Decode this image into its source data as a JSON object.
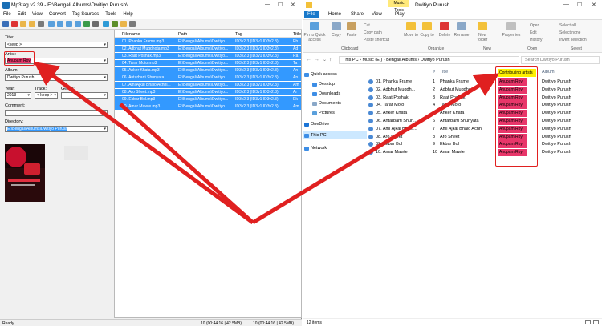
{
  "mp3tag": {
    "title": "Mp3tag v2.39  -  E:\\Bengali Albums\\Dwitiyo Purush\\",
    "menu": [
      "File",
      "Edit",
      "View",
      "Convert",
      "Tag Sources",
      "Tools",
      "Help"
    ],
    "fields": {
      "title_label": "Title:",
      "title_value": "<keep >",
      "artist_label": "Artist:",
      "artist_value": "Anupam Roy",
      "album_label": "Album:",
      "album_value": "Dwitiyo Purush",
      "year_label": "Year:",
      "year_value": "2013",
      "track_label": "Track:",
      "track_value": "< keep >",
      "genre_label": "Genre:",
      "comment_label": "Comment:",
      "directory_label": "Directory:",
      "directory_value": "E:\\Bengali Albums\\Dwitiyo Purush"
    },
    "columns": [
      "Filename",
      "Path",
      "Tag",
      "Title"
    ],
    "files": [
      {
        "filename": "01. Phanka Frame.mp3",
        "path": "E:\\Bengali Albums\\Dwitiyo...",
        "tag": "ID3v2.3 (ID3v1 ID3v2.3)",
        "title": "Ph"
      },
      {
        "filename": "02. Adbhut Mugdhota.mp3",
        "path": "E:\\Bengali Albums\\Dwitiyo...",
        "tag": "ID3v2.3 (ID3v1 ID3v2.3)",
        "title": "Ad"
      },
      {
        "filename": "03. Raat Poshak.mp3",
        "path": "E:\\Bengali Albums\\Dwitiyo...",
        "tag": "ID3v2.3 (ID3v1 ID3v2.3)",
        "title": "Ra"
      },
      {
        "filename": "04. Tarar Moto.mp3",
        "path": "E:\\Bengali Albums\\Dwitiyo...",
        "tag": "ID3v2.3 (ID3v1 ID3v2.3)",
        "title": "Ta"
      },
      {
        "filename": "05. Anker Khata.mp3",
        "path": "E:\\Bengali Albums\\Dwitiyo...",
        "tag": "ID3v2.3 (ID3v1 ID3v2.3)",
        "title": "An"
      },
      {
        "filename": "06. Antarbarti Shunyata...",
        "path": "E:\\Bengali Albums\\Dwitiyo...",
        "tag": "ID3v2.3 (ID3v1 ID3v2.3)",
        "title": "An"
      },
      {
        "filename": "07. Ami Ajkal Bhalo Achhi...",
        "path": "E:\\Bengali Albums\\Dwitiyo...",
        "tag": "ID3v2.3 (ID3v1 ID3v2.3)",
        "title": "Am"
      },
      {
        "filename": "08. Aro Sheet.mp3",
        "path": "E:\\Bengali Albums\\Dwitiyo...",
        "tag": "ID3v2.3 (ID3v1 ID3v2.3)",
        "title": "Ar"
      },
      {
        "filename": "09. Ekbar Bol.mp3",
        "path": "E:\\Bengali Albums\\Dwitiyo...",
        "tag": "ID3v2.3 (ID3v1 ID3v2.3)",
        "title": "Ek"
      },
      {
        "filename": "10. Amar Mawte.mp3",
        "path": "E:\\Bengali Albums\\Dwitiyo...",
        "tag": "ID3v2.3 (ID3v1 ID3v2.3)",
        "title": "Am"
      }
    ],
    "status": {
      "left": "Ready",
      "mid": "10 (00:44:16 | 42.5MB)",
      "right": "10 (00:44:16 | 42.5MB)"
    }
  },
  "explorer": {
    "title": "Dwitiyo Purush",
    "music_tools": "Music Tools",
    "tabs": [
      "File",
      "Home",
      "Share",
      "View",
      "Play"
    ],
    "ribbon": {
      "pin": "Pin to Quick access",
      "copy": "Copy",
      "paste": "Paste",
      "cut": "Cut",
      "copy_path": "Copy path",
      "paste_shortcut": "Paste shortcut",
      "move_to": "Move to",
      "copy_to": "Copy to",
      "delete": "Delete",
      "rename": "Rename",
      "new_folder": "New folder",
      "properties": "Properties",
      "open": "Open",
      "edit": "Edit",
      "history": "History",
      "select_all": "Select all",
      "select_none": "Select none",
      "invert": "Invert selection",
      "groups": [
        "Clipboard",
        "Organize",
        "New",
        "Open",
        "Select"
      ]
    },
    "address": "This PC  ›  Music (E:)  ›  Bengali Albums  ›  Dwitiyo Purush",
    "search_placeholder": "Search Dwitiyo Purush",
    "nav": [
      "Quick access",
      "Desktop",
      "Downloads",
      "Documents",
      "Pictures",
      "OneDrive",
      "This PC",
      "Network"
    ],
    "columns": {
      "num": "#",
      "title": "Title",
      "contrib": "Contributing artists",
      "album": "Album"
    },
    "rows": [
      {
        "name": "01. Phanka Frame",
        "num": "1",
        "title": "Phanka Frame",
        "artist": "Anupam Roy",
        "album": "Dwitiyo Purush"
      },
      {
        "name": "02. Adbhut Mugdh...",
        "num": "2",
        "title": "Adbhut Mugdhota",
        "artist": "Anupam Roy",
        "album": "Dwitiyo Purush"
      },
      {
        "name": "03. Raat Poshak",
        "num": "3",
        "title": "Raat Poshak",
        "artist": "Anupam Roy",
        "album": "Dwitiyo Purush"
      },
      {
        "name": "04. Tarar Moto",
        "num": "4",
        "title": "Tarar Moto",
        "artist": "Anupam Roy",
        "album": "Dwitiyo Purush"
      },
      {
        "name": "05. Anker Khata",
        "num": "5",
        "title": "Anker Khata",
        "artist": "Anupam Roy",
        "album": "Dwitiyo Purush"
      },
      {
        "name": "06. Antarbarti Shun...",
        "num": "6",
        "title": "Antarbarti Shunyata",
        "artist": "Anupam Roy",
        "album": "Dwitiyo Purush"
      },
      {
        "name": "07. Ami Ajkal Bhalo...",
        "num": "7",
        "title": "Ami Ajkal Bhalo Achhi",
        "artist": "Anupam Roy",
        "album": "Dwitiyo Purush"
      },
      {
        "name": "08. Aro Sheet",
        "num": "8",
        "title": "Aro Sheet",
        "artist": "Anupam Roy",
        "album": "Dwitiyo Purush"
      },
      {
        "name": "09. Ekbar Bol",
        "num": "9",
        "title": "Ekbar Bol",
        "artist": "Anupam Roy",
        "album": "Dwitiyo Purush"
      },
      {
        "name": "10. Amar Mawte",
        "num": "10",
        "title": "Amar Mawte",
        "artist": "Anupam Roy",
        "album": "Dwitiyo Purush"
      }
    ],
    "status": "12 items"
  },
  "colors": {
    "selection": "#3399ff",
    "highlight_red": "#e8366a",
    "highlight_yellow": "#fff000",
    "arrow": "#e02020",
    "file_tab": "#1979ca"
  }
}
